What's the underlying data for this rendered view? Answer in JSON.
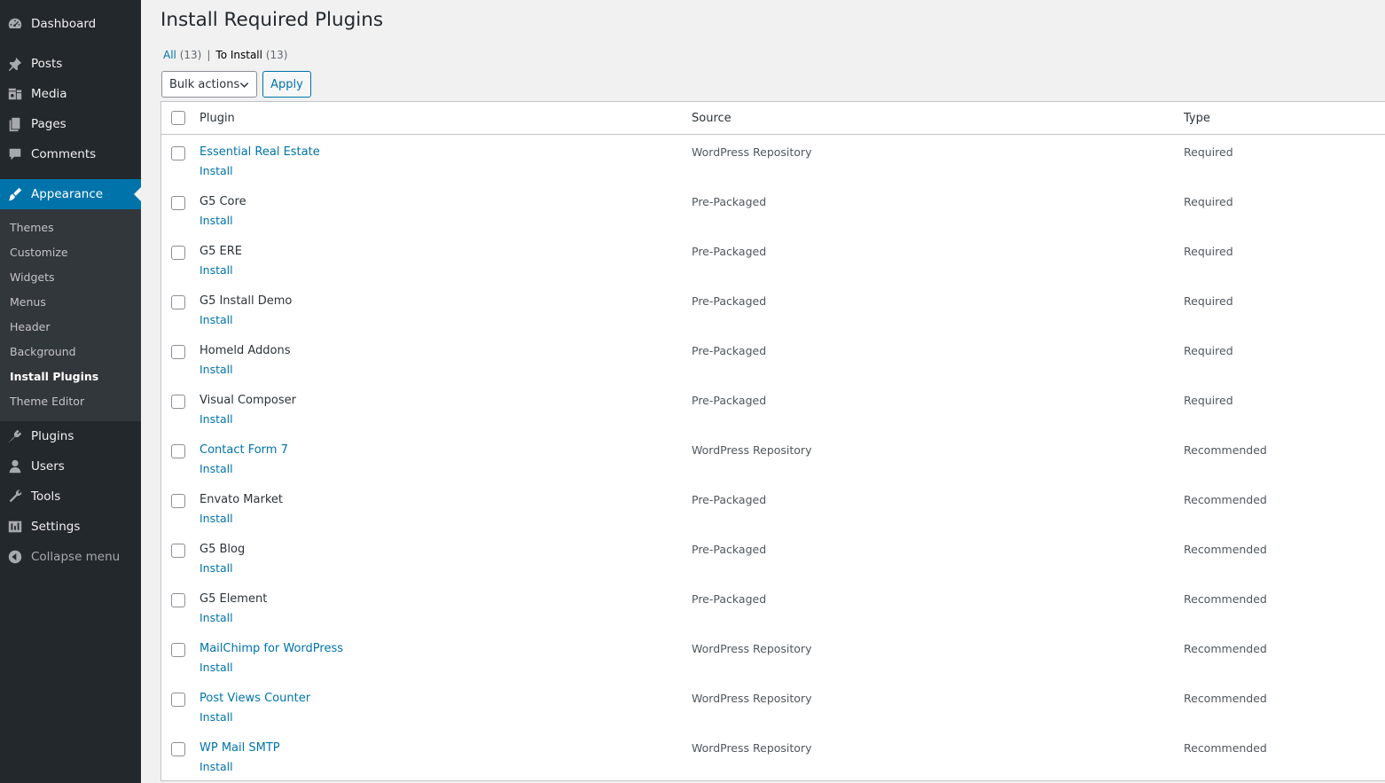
{
  "sidebar": {
    "menu": [
      {
        "label": "Dashboard",
        "icon": "dashboard-icon"
      },
      {
        "label": "Posts",
        "icon": "pushpin-icon"
      },
      {
        "label": "Media",
        "icon": "media-icon"
      },
      {
        "label": "Pages",
        "icon": "pages-icon"
      },
      {
        "label": "Comments",
        "icon": "comments-icon"
      },
      {
        "label": "Appearance",
        "icon": "paintbrush-icon"
      },
      {
        "label": "Plugins",
        "icon": "plugin-icon"
      },
      {
        "label": "Users",
        "icon": "user-icon"
      },
      {
        "label": "Tools",
        "icon": "wrench-icon"
      },
      {
        "label": "Settings",
        "icon": "settings-icon"
      },
      {
        "label": "Collapse menu",
        "icon": "collapse-icon"
      }
    ],
    "submenu": [
      {
        "label": "Themes"
      },
      {
        "label": "Customize"
      },
      {
        "label": "Widgets"
      },
      {
        "label": "Menus"
      },
      {
        "label": "Header"
      },
      {
        "label": "Background"
      },
      {
        "label": "Install Plugins"
      },
      {
        "label": "Theme Editor"
      }
    ],
    "accent_color": "#0073aa",
    "background_color": "#23282d"
  },
  "main": {
    "title": "Install Required Plugins",
    "filters": {
      "all_label": "All",
      "all_count": "(13)",
      "separator": "|",
      "to_install_label": "To Install",
      "to_install_count": "(13)"
    },
    "bulk_actions_label": "Bulk actions",
    "apply_label": "Apply",
    "table": {
      "headers": {
        "plugin": "Plugin",
        "source": "Source",
        "type": "Type"
      },
      "action_label": "Install",
      "rows": [
        {
          "name": "Essential Real Estate",
          "source": "WordPress Repository",
          "type": "Required"
        },
        {
          "name": "G5 Core",
          "source": "Pre-Packaged",
          "type": "Required"
        },
        {
          "name": "G5 ERE",
          "source": "Pre-Packaged",
          "type": "Required"
        },
        {
          "name": "G5 Install Demo",
          "source": "Pre-Packaged",
          "type": "Required"
        },
        {
          "name": "Homeld Addons",
          "source": "Pre-Packaged",
          "type": "Required"
        },
        {
          "name": "Visual Composer",
          "source": "Pre-Packaged",
          "type": "Required"
        },
        {
          "name": "Contact Form 7",
          "source": "WordPress Repository",
          "type": "Recommended"
        },
        {
          "name": "Envato Market",
          "source": "Pre-Packaged",
          "type": "Recommended"
        },
        {
          "name": "G5 Blog",
          "source": "Pre-Packaged",
          "type": "Recommended"
        },
        {
          "name": "G5 Element",
          "source": "Pre-Packaged",
          "type": "Recommended"
        },
        {
          "name": "MailChimp for WordPress",
          "source": "WordPress Repository",
          "type": "Recommended"
        },
        {
          "name": "Post Views Counter",
          "source": "WordPress Repository",
          "type": "Recommended"
        },
        {
          "name": "WP Mail SMTP",
          "source": "WordPress Repository",
          "type": "Recommended"
        }
      ]
    }
  }
}
